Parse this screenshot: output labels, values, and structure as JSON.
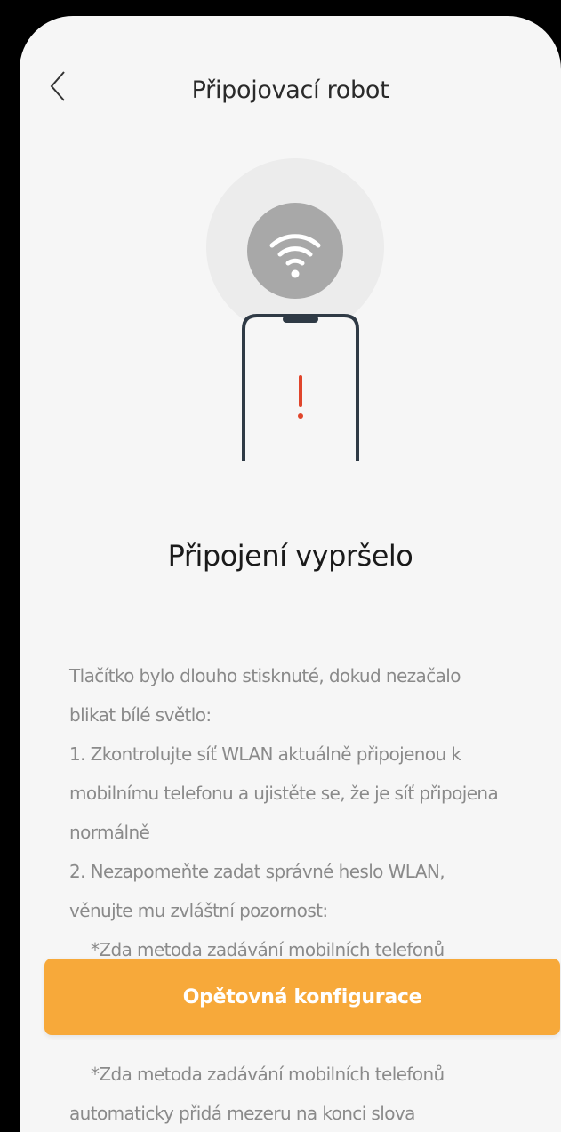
{
  "header": {
    "title": "Připojovací robot"
  },
  "status": {
    "heading": "Připojení vypršelo"
  },
  "instructions": {
    "lines": [
      "Tlačítko bylo dlouho stisknuté, dokud nezačalo",
      "blikat bílé světlo:",
      "1. Zkontrolujte síť WLAN aktuálně připojenou k",
      "mobilnímu telefonu a ujistěte se, že je síť připojena",
      "normálně",
      "2. Nezapomeňte zadat správné heslo WLAN,",
      "věnujte mu zvláštní pozornost:",
      "*Zda metoda zadávání mobilních telefonů"
    ],
    "lines_after": [
      "*Zda metoda zadávání mobilních telefonů",
      "automaticky přidá mezeru na konci slova"
    ]
  },
  "cta": {
    "label": "Opětovná konfigurace"
  },
  "colors": {
    "accent": "#f7a93a",
    "alert": "#e0452b"
  },
  "icons": {
    "back": "chevron-left-icon",
    "wifi": "wifi-icon",
    "phone": "phone-icon",
    "alert": "exclamation-icon"
  }
}
